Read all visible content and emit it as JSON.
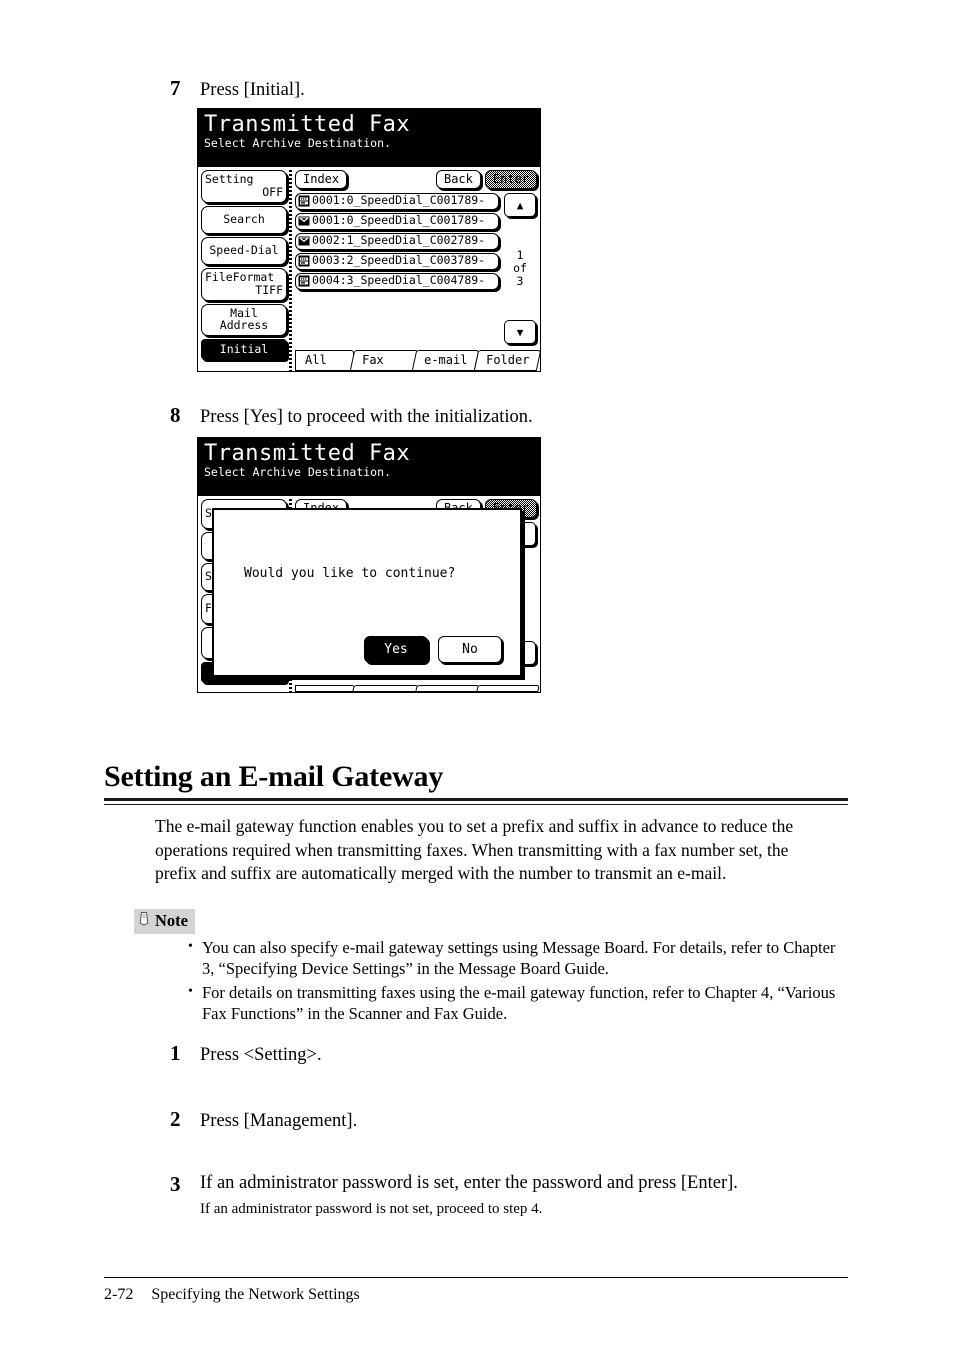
{
  "page": {
    "footer_page_number": "2-72",
    "footer_title": "Specifying the Network Settings"
  },
  "steps_top": [
    {
      "num": "7",
      "text": "Press [Initial]."
    },
    {
      "num": "8",
      "text": "Press [Yes] to proceed with the initialization."
    }
  ],
  "lcd_one": {
    "title": "Transmitted Fax",
    "subtitle": "Select Archive Destination.",
    "side_buttons": [
      {
        "line1": "Setting",
        "line2": "OFF",
        "state": "normal"
      },
      {
        "line1": "Search",
        "line2": "",
        "state": "normal"
      },
      {
        "line1": "Speed-Dial",
        "line2": "",
        "state": "normal"
      },
      {
        "line1": "FileFormat",
        "line2": "TIFF",
        "state": "normal"
      },
      {
        "line1": "Mail",
        "line2": "Address",
        "state": "normal"
      },
      {
        "line1": "Initial",
        "line2": "",
        "state": "selected"
      }
    ],
    "top_buttons": {
      "index": "Index",
      "back": "Back",
      "enter": "Enter"
    },
    "entries": [
      {
        "icon": "fax-icon",
        "label": "0001:0_SpeedDial_C001789-"
      },
      {
        "icon": "email-icon",
        "label": "0001:0_SpeedDial_C001789-"
      },
      {
        "icon": "email-icon",
        "label": "0002:1_SpeedDial_C002789-"
      },
      {
        "icon": "fax-icon",
        "label": "0003:2_SpeedDial_C003789-"
      },
      {
        "icon": "fax-icon",
        "label": "0004:3_SpeedDial_C004789-"
      }
    ],
    "scroll": {
      "up": "▲",
      "down": "▼",
      "page_current": "1",
      "page_of": "of",
      "page_total": "3"
    },
    "tabs": [
      "All",
      "Fax",
      "e-mail",
      "Folder"
    ]
  },
  "lcd_two": {
    "title": "Transmitted Fax",
    "subtitle": "Select Archive Destination.",
    "dialog": {
      "message": "Would you like to continue?",
      "yes": "Yes",
      "no": "No"
    },
    "background_fragments": {
      "setting": "Setting",
      "index": "Index",
      "back": "Back",
      "enter": "Enter",
      "speed_dial_frag": "S",
      "fileformat_frag": "F"
    }
  },
  "section": {
    "heading": "Setting an E-mail Gateway",
    "paragraph": "The e-mail gateway function enables you to set a prefix and suffix in advance to reduce the operations required when transmitting faxes. When transmitting with a fax number set, the prefix and suffix are automatically merged with the number to transmit an e-mail."
  },
  "note": {
    "label": "Note",
    "items": [
      "You can also specify e-mail gateway settings using Message Board. For details, refer to Chapter 3, “Specifying Device Settings” in the Message Board Guide.",
      "For details on transmitting faxes using the e-mail gateway function, refer to Chapter 4, “Various Fax Functions” in the Scanner and Fax Guide."
    ],
    "bullet": "•"
  },
  "steps_bottom": [
    {
      "num": "1",
      "text": "Press <Setting>.",
      "sub": ""
    },
    {
      "num": "2",
      "text": "Press [Management].",
      "sub": ""
    },
    {
      "num": "3",
      "text": "If an administrator password is set, enter the password and press [Enter].",
      "sub": "If an administrator password is not set, proceed to step 4."
    }
  ]
}
